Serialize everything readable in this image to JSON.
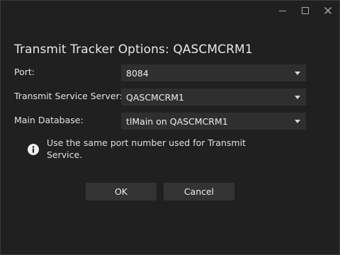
{
  "window": {
    "controls": {
      "minimize_icon": "minimize-icon",
      "maximize_icon": "maximize-icon",
      "close_icon": "close-icon"
    }
  },
  "dialog": {
    "title": "Transmit Tracker Options: QASCMCRM1",
    "fields": [
      {
        "label": "Port:",
        "value": "8084"
      },
      {
        "label": "Transmit Service Server:",
        "value": "QASCMCRM1"
      },
      {
        "label": "Main Database:",
        "value": "tlMain on QASCMCRM1"
      }
    ],
    "info": {
      "icon": "info-icon",
      "text": "Use the same port number used for Transmit Service."
    },
    "buttons": {
      "ok": "OK",
      "cancel": "Cancel"
    }
  },
  "colors": {
    "background": "#202020",
    "control": "#2f2f2f",
    "button": "#333333",
    "text": "#e6e6e6"
  }
}
